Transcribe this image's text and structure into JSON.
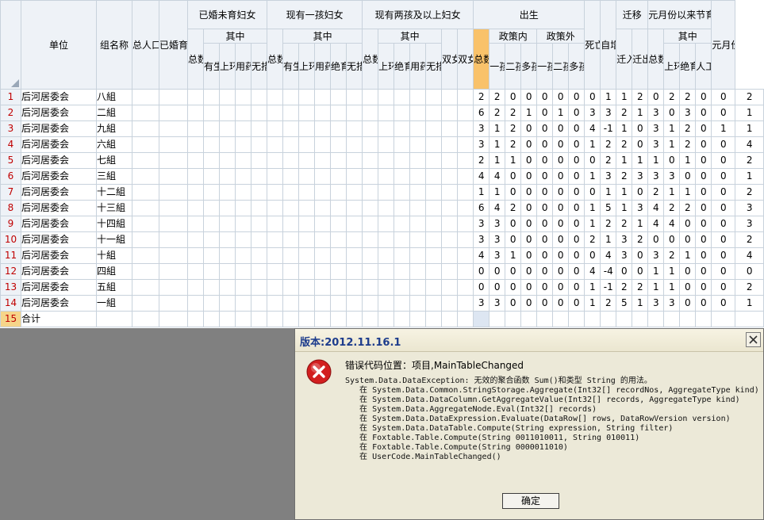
{
  "headers": {
    "unit": "单位",
    "group": "组名称",
    "total_pop": "总人口数",
    "married_women": "已婚育龄妇女",
    "unborn": {
      "title": "已婚未育妇女",
      "sub": "其中",
      "cols": [
        "总数",
        "有生育证",
        "上环",
        "用药具",
        "无措施"
      ]
    },
    "one_child": {
      "title": "现有一孩妇女",
      "sub": "其中",
      "cols": [
        "总数",
        "有生育证",
        "上环",
        "用药具",
        "绝育",
        "无措施"
      ]
    },
    "two_plus": {
      "title": "现有两孩及以上妇女",
      "sub": "其中",
      "cols": [
        "总数",
        "上环",
        "绝育",
        "用药具",
        "无措施",
        "双女户",
        "双女绝育户"
      ]
    },
    "birth": {
      "title": "出生",
      "total": "总数",
      "in_policy": "政策内",
      "out_policy": "政策外",
      "kids": [
        "一孩",
        "二孩",
        "多孩"
      ]
    },
    "death": "死亡人数",
    "natural": "自增人数",
    "migration": {
      "title": "迁移",
      "cols": [
        "迁入人数",
        "迁出人数"
      ]
    },
    "surgery": {
      "title": "元月份以来节育手术人数",
      "total": "总数",
      "sub": "其中",
      "cols": [
        "上环",
        "绝育",
        "人工流产"
      ]
    },
    "newly_married": "元月份以来新婚对数"
  },
  "rows": [
    {
      "n": "1",
      "unit": "后河居委会",
      "group": "八組",
      "vals": [
        "2",
        "2",
        "0",
        "0",
        "0",
        "0",
        "0",
        "0",
        "1",
        "1",
        "2",
        "0",
        "2",
        "2",
        "0",
        "0",
        "2"
      ]
    },
    {
      "n": "2",
      "unit": "后河居委会",
      "group": "二組",
      "vals": [
        "6",
        "2",
        "2",
        "1",
        "0",
        "1",
        "0",
        "3",
        "3",
        "2",
        "1",
        "3",
        "0",
        "3",
        "0",
        "0",
        "1"
      ]
    },
    {
      "n": "3",
      "unit": "后河居委会",
      "group": "九組",
      "vals": [
        "3",
        "1",
        "2",
        "0",
        "0",
        "0",
        "0",
        "4",
        "-1",
        "1",
        "0",
        "3",
        "1",
        "2",
        "0",
        "1",
        "1"
      ]
    },
    {
      "n": "4",
      "unit": "后河居委会",
      "group": "六組",
      "vals": [
        "3",
        "1",
        "2",
        "0",
        "0",
        "0",
        "0",
        "1",
        "2",
        "2",
        "0",
        "3",
        "1",
        "2",
        "0",
        "0",
        "4"
      ]
    },
    {
      "n": "5",
      "unit": "后河居委会",
      "group": "七組",
      "vals": [
        "2",
        "1",
        "1",
        "0",
        "0",
        "0",
        "0",
        "0",
        "2",
        "1",
        "1",
        "1",
        "0",
        "1",
        "0",
        "0",
        "2"
      ]
    },
    {
      "n": "6",
      "unit": "后河居委会",
      "group": "三組",
      "vals": [
        "4",
        "4",
        "0",
        "0",
        "0",
        "0",
        "0",
        "1",
        "3",
        "2",
        "3",
        "3",
        "3",
        "0",
        "0",
        "0",
        "1"
      ]
    },
    {
      "n": "7",
      "unit": "后河居委会",
      "group": "十二組",
      "vals": [
        "1",
        "1",
        "0",
        "0",
        "0",
        "0",
        "0",
        "0",
        "1",
        "1",
        "0",
        "2",
        "1",
        "1",
        "0",
        "0",
        "2"
      ]
    },
    {
      "n": "8",
      "unit": "后河居委会",
      "group": "十三組",
      "vals": [
        "6",
        "4",
        "2",
        "0",
        "0",
        "0",
        "0",
        "1",
        "5",
        "1",
        "3",
        "4",
        "2",
        "2",
        "0",
        "0",
        "3"
      ]
    },
    {
      "n": "9",
      "unit": "后河居委会",
      "group": "十四組",
      "vals": [
        "3",
        "3",
        "0",
        "0",
        "0",
        "0",
        "0",
        "1",
        "2",
        "2",
        "1",
        "4",
        "4",
        "0",
        "0",
        "0",
        "3"
      ]
    },
    {
      "n": "10",
      "unit": "后河居委会",
      "group": "十一組",
      "vals": [
        "3",
        "3",
        "0",
        "0",
        "0",
        "0",
        "0",
        "2",
        "1",
        "3",
        "2",
        "0",
        "0",
        "0",
        "0",
        "0",
        "2"
      ]
    },
    {
      "n": "11",
      "unit": "后河居委会",
      "group": "十組",
      "vals": [
        "4",
        "3",
        "1",
        "0",
        "0",
        "0",
        "0",
        "0",
        "4",
        "3",
        "0",
        "3",
        "2",
        "1",
        "0",
        "0",
        "4"
      ]
    },
    {
      "n": "12",
      "unit": "后河居委会",
      "group": "四組",
      "vals": [
        "0",
        "0",
        "0",
        "0",
        "0",
        "0",
        "0",
        "4",
        "-4",
        "0",
        "0",
        "1",
        "1",
        "0",
        "0",
        "0",
        "0"
      ]
    },
    {
      "n": "13",
      "unit": "后河居委会",
      "group": "五組",
      "vals": [
        "0",
        "0",
        "0",
        "0",
        "0",
        "0",
        "0",
        "1",
        "-1",
        "2",
        "2",
        "1",
        "1",
        "0",
        "0",
        "0",
        "2"
      ]
    },
    {
      "n": "14",
      "unit": "后河居委会",
      "group": "一組",
      "vals": [
        "3",
        "3",
        "0",
        "0",
        "0",
        "0",
        "0",
        "1",
        "2",
        "5",
        "1",
        "3",
        "3",
        "0",
        "0",
        "0",
        "1"
      ]
    }
  ],
  "total_row": {
    "n": "15",
    "label": "合计"
  },
  "dialog": {
    "title": "版本:2012.11.16.1",
    "location": "错误代码位置：项目,MainTableChanged",
    "stack": [
      "System.Data.DataException: 无效的聚合函数 Sum()和类型 String 的用法。",
      "   在 System.Data.Common.StringStorage.Aggregate(Int32[] recordNos, AggregateType kind)",
      "   在 System.Data.DataColumn.GetAggregateValue(Int32[] records, AggregateType kind)",
      "   在 System.Data.AggregateNode.Eval(Int32[] records)",
      "   在 System.Data.DataExpression.Evaluate(DataRow[] rows, DataRowVersion version)",
      "   在 System.Data.DataTable.Compute(String expression, String filter)",
      "   在 Foxtable.Table.Compute(String 0011010011, String 010011)",
      "   在 Foxtable.Table.Compute(String 0000011010)",
      "   在 UserCode.MainTableChanged()"
    ],
    "ok_label": "确定"
  },
  "colors": {
    "accent_header": "#f9c26a",
    "row_number": "#c00000",
    "dialog_title": "#1d3c8c",
    "error_icon": "#d21f1f"
  }
}
